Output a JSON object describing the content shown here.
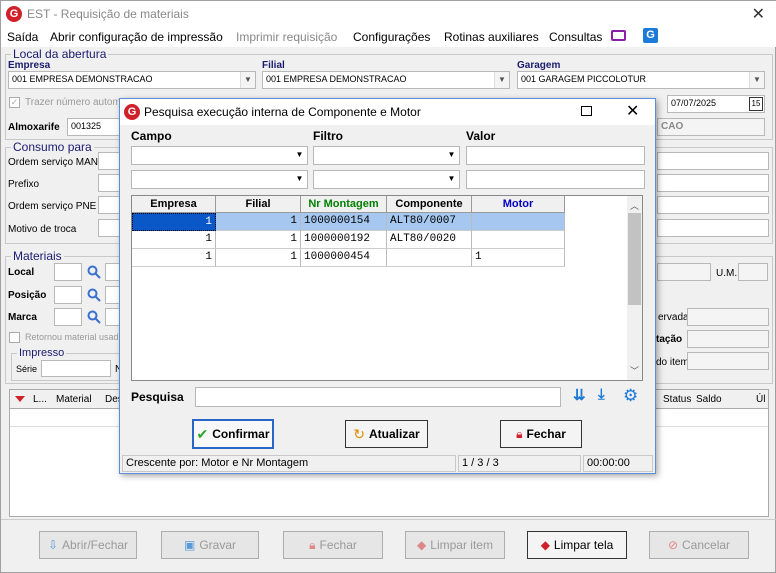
{
  "window": {
    "title": "EST - Requisição de materiais"
  },
  "menu": [
    "Saída",
    "Abrir configuração de impressão",
    "Imprimir requisição",
    "Configurações",
    "Rotinas auxiliares",
    "Consultas"
  ],
  "local_abertura": {
    "group": "Local da abertura",
    "empresa_label": "Empresa",
    "empresa_value": "001 EMPRESA DEMONSTRACAO",
    "filial_label": "Filial",
    "filial_value": "001 EMPRESA DEMONSTRACAO",
    "garagem_label": "Garagem",
    "garagem_value": "001 GARAGEM PICCOLOTUR",
    "trazer_label": "Trazer número automa",
    "date_value": "07/07/2025",
    "almox_label": "Almoxarife",
    "almox_value": "001325",
    "almox_name_suffix": "CAO"
  },
  "consumo": {
    "group": "Consumo para",
    "os_man": "Ordem serviço MAN",
    "prefixo": "Prefixo",
    "os_pne": "Ordem serviço PNE",
    "motivo": "Motivo de troca"
  },
  "materiais": {
    "group": "Materiais",
    "local": "Local",
    "posicao": "Posição",
    "marca": "Marca",
    "um": "U.M.",
    "ervada": "ervada",
    "tacao": "tação",
    "do_item": "do item",
    "retornou": "Retornou material usad",
    "impresso_group": "Impresso",
    "serie": "Série",
    "n": "N"
  },
  "items_grid": {
    "columns": [
      "L...",
      "Material",
      "Des",
      "Status",
      "Saldo",
      "Úl"
    ]
  },
  "bottom_buttons": [
    "Abrir/Fechar",
    "Gravar",
    "Fechar",
    "Limpar item",
    "Limpar tela",
    "Cancelar"
  ],
  "dialog": {
    "title": "Pesquisa execução interna de Componente e Motor",
    "campo": "Campo",
    "filtro": "Filtro",
    "valor": "Valor",
    "columns": [
      "Empresa",
      "Filial",
      "Nr Montagem",
      "Componente",
      "Motor"
    ],
    "column_colors": [
      "#000000",
      "#000000",
      "#008000",
      "#000000",
      "#0000c0"
    ],
    "rows": [
      [
        "1",
        "1",
        "1000000154",
        "ALT80/0007",
        ""
      ],
      [
        "1",
        "1",
        "1000000192",
        "ALT80/0020",
        ""
      ],
      [
        "1",
        "1",
        "1000000454",
        "",
        "1"
      ]
    ],
    "pesquisa": "Pesquisa",
    "buttons": [
      "Confirmar",
      "Atualizar",
      "Fechar"
    ],
    "status_sort": "Crescente por: Motor e Nr Montagem",
    "status_count": "1 / 3 / 3",
    "status_time": "00:00:00"
  }
}
